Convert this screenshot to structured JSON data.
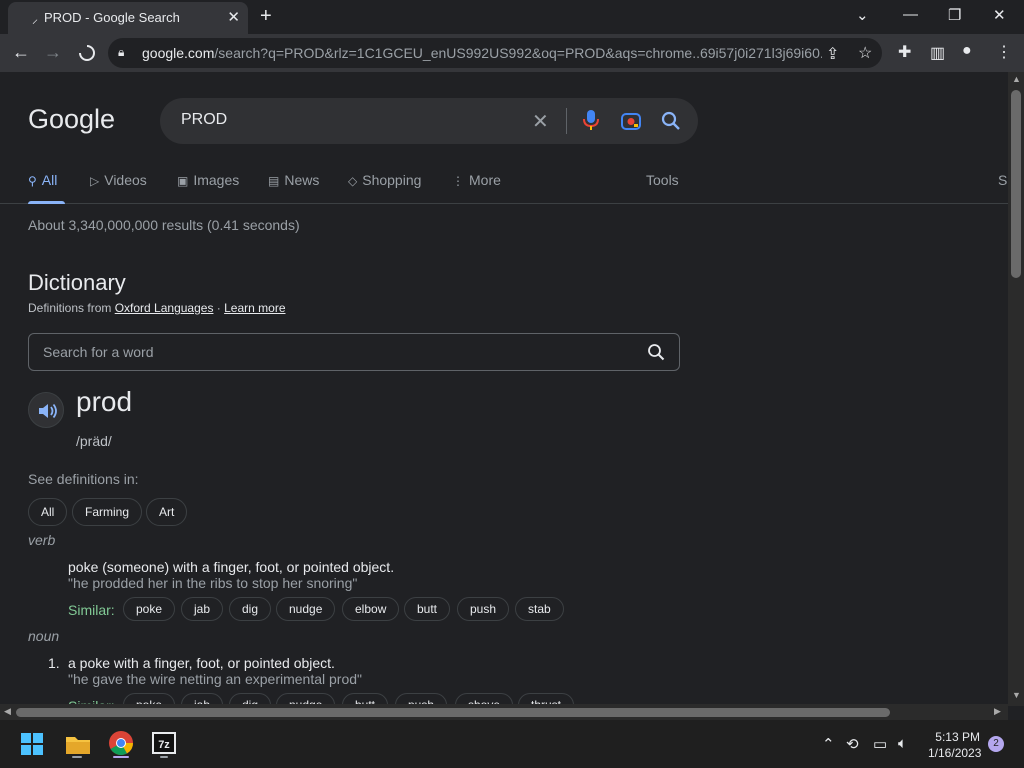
{
  "browser": {
    "tab_title": "PROD - Google Search",
    "url_host": "google.com",
    "url_rest": "/search?q=PROD&rlz=1C1GCEU_enUS992US992&oq=PROD&aqs=chrome..69i57j0i271l3j69i60..."
  },
  "search": {
    "logo": "Google",
    "query": "PROD"
  },
  "tabs": {
    "all": "All",
    "videos": "Videos",
    "images": "Images",
    "news": "News",
    "shopping": "Shopping",
    "more": "More",
    "tools": "Tools",
    "cut": "S"
  },
  "stats": "About 3,340,000,000 results (0.41 seconds)",
  "dictionary": {
    "title": "Dictionary",
    "source_prefix": "Definitions from ",
    "source_link": "Oxford Languages",
    "source_sep": " · ",
    "learn_more": "Learn more",
    "search_placeholder": "Search for a word",
    "word": "prod",
    "phonetic": "/präd/",
    "see_definitions": "See definitions in:",
    "chips": [
      "All",
      "Farming",
      "Art"
    ],
    "verb_pos": "verb",
    "verb_def": "poke (someone) with a finger, foot, or pointed object.",
    "verb_example": "\"he prodded her in the ribs to stop her snoring\"",
    "similar_label": "Similar:",
    "verb_synonyms": [
      "poke",
      "jab",
      "dig",
      "nudge",
      "elbow",
      "butt",
      "push",
      "stab"
    ],
    "noun_pos": "noun",
    "noun_num": "1.",
    "noun_def": "a poke with a finger, foot, or pointed object.",
    "noun_example": "\"he gave the wire netting an experimental prod\"",
    "noun_synonyms": [
      "poke",
      "jab",
      "dig",
      "nudge",
      "butt",
      "push",
      "shove",
      "thrust"
    ]
  },
  "taskbar": {
    "time": "5:13 PM",
    "date": "1/16/2023",
    "notifications": "2"
  }
}
